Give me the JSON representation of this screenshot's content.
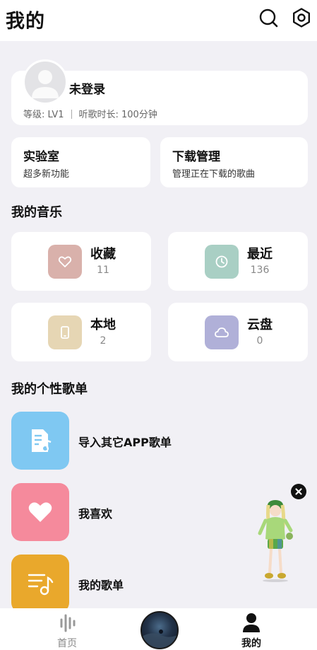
{
  "header": {
    "title": "我的",
    "search_icon": "search-icon",
    "settings_icon": "settings-icon"
  },
  "profile": {
    "name": "未登录",
    "level": "等级: LV1",
    "listen_time": "听歌时长: 100分钟"
  },
  "features": [
    {
      "title": "实验室",
      "subtitle": "超多新功能"
    },
    {
      "title": "下载管理",
      "subtitle": "管理正在下载的歌曲"
    }
  ],
  "my_music": {
    "section_title": "我的音乐",
    "items": [
      {
        "label": "收藏",
        "count": "11",
        "icon": "heart-icon",
        "color": "#d9b1ab"
      },
      {
        "label": "最近",
        "count": "136",
        "icon": "clock-icon",
        "color": "#a9cfc4"
      },
      {
        "label": "本地",
        "count": "2",
        "icon": "phone-icon",
        "color": "#e6d6b4"
      },
      {
        "label": "云盘",
        "count": "0",
        "icon": "cloud-icon",
        "color": "#b0b0d8"
      }
    ]
  },
  "playlists": {
    "section_title": "我的个性歌单",
    "items": [
      {
        "name": "导入其它APP歌单",
        "icon": "music-document-icon",
        "color": "#7fc8f2"
      },
      {
        "name": "我喜欢",
        "icon": "heart-icon",
        "color": "#f58a9c"
      },
      {
        "name": "我的歌单",
        "icon": "playlist-icon",
        "color": "#e9a82c"
      }
    ]
  },
  "bottom_nav": {
    "home": "首页",
    "mine": "我的"
  }
}
